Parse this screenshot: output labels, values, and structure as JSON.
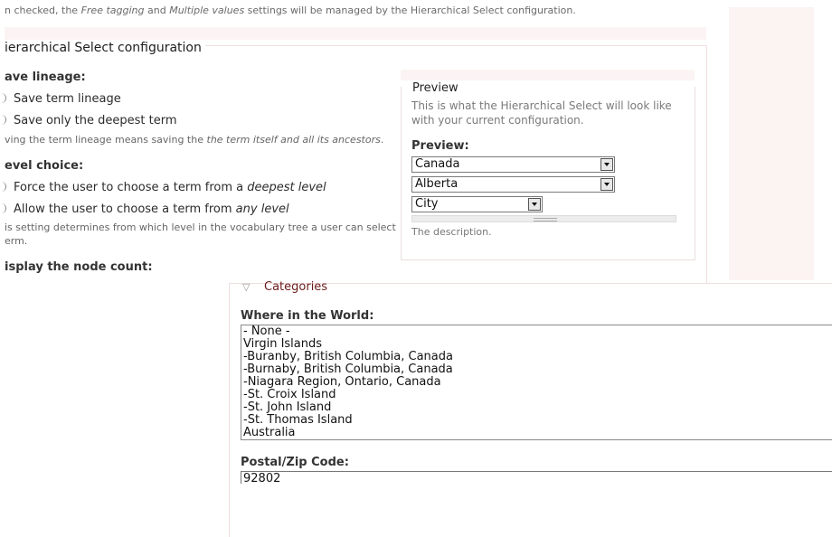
{
  "top_note": {
    "pre": "n checked, the ",
    "free_tagging": "Free tagging",
    "mid": " and ",
    "multiple_values": "Multiple values",
    "post": " settings will be managed by the Hierarchical Select configuration."
  },
  "hs_config": {
    "legend": "ierarchical Select configuration",
    "save_lineage": {
      "label": "ave lineage:",
      "options": [
        "Save term lineage",
        "Save only the deepest term"
      ],
      "desc_pre": "ving the term lineage means saving the ",
      "desc_em": "the term itself and all its ancestors",
      "desc_post": "."
    },
    "level_choice": {
      "label": "evel choice:",
      "option1_pre": "Force the user to choose a term from a ",
      "option1_em": "deepest level",
      "option2_pre": "Allow the user to choose a term from ",
      "option2_em": "any level",
      "desc_line1": "is setting determines from which level in the vocabulary tree a user can select",
      "desc_line2": "erm."
    },
    "node_count_label": "isplay the node count:"
  },
  "preview": {
    "legend": "Preview",
    "description": "This is what the Hierarchical Select will look like with your current configuration.",
    "label": "Preview:",
    "selects": [
      "Canada",
      "Alberta",
      "City"
    ],
    "footer": "The description."
  },
  "categories": {
    "legend": "Categories",
    "collapse_glyph": "▽",
    "where_label": "Where in the World:",
    "where_items": [
      "- None -",
      "Virgin Islands",
      "-Buranby, British Columbia, Canada",
      "-Burnaby, British Columbia, Canada",
      "-Niagara Region, Ontario, Canada",
      "-St. Croix Island",
      "-St. John Island",
      "-St. Thomas Island",
      "Australia"
    ],
    "postal_label": "Postal/Zip Code:",
    "postal_value": "92802"
  }
}
